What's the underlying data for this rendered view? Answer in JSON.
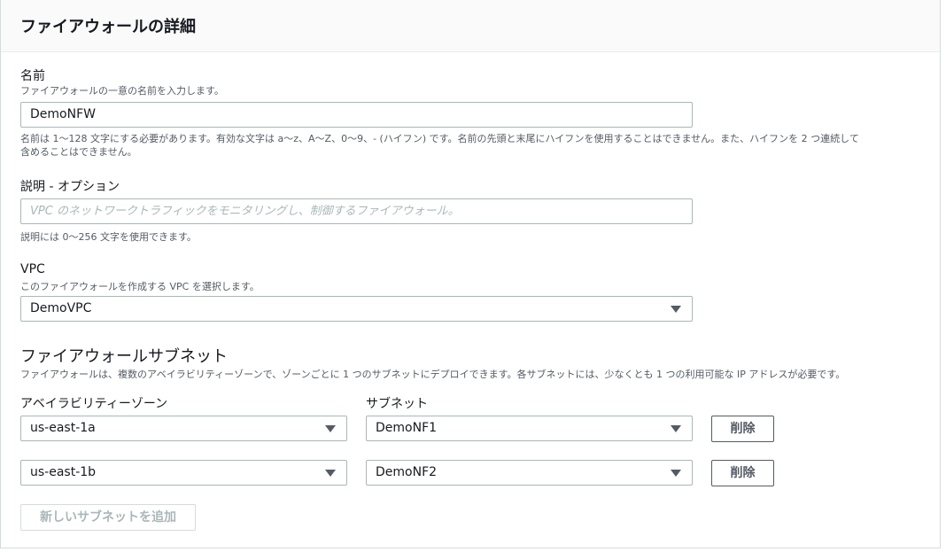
{
  "panel": {
    "title": "ファイアウォールの詳細"
  },
  "name_field": {
    "label": "名前",
    "description": "ファイアウォールの一意の名前を入力します。",
    "value": "DemoNFW",
    "constraint_line1": "名前は 1〜128 文字にする必要があります。有効な文字は a〜z、A〜Z、0〜9、- (ハイフン) です。名前の先頭と末尾にハイフンを使用することはできません。また、ハイフンを 2 つ連続して",
    "constraint_line2": "含めることはできません。"
  },
  "description_field": {
    "label": "説明 - オプション",
    "placeholder": "VPC のネットワークトラフィックをモニタリングし、制御するファイアウォール。",
    "constraint": "説明には 0〜256 文字を使用できます。"
  },
  "vpc_field": {
    "label": "VPC",
    "description": "このファイアウォールを作成する VPC を選択します。",
    "value": "DemoVPC"
  },
  "subnets": {
    "title": "ファイアウォールサブネット",
    "description": "ファイアウォールは、複数のアベイラビリティーゾーンで、ゾーンごとに 1 つのサブネットにデプロイできます。各サブネットには、少なくとも 1 つの利用可能な IP アドレスが必要です。",
    "az_header": "アベイラビリティーゾーン",
    "subnet_header": "サブネット",
    "rows": [
      {
        "az": "us-east-1a",
        "subnet": "DemoNF1",
        "remove_label": "削除"
      },
      {
        "az": "us-east-1b",
        "subnet": "DemoNF2",
        "remove_label": "削除"
      }
    ],
    "add_button_label": "新しいサブネットを追加"
  },
  "icons": {
    "dropdown": "chevron-down-icon"
  }
}
